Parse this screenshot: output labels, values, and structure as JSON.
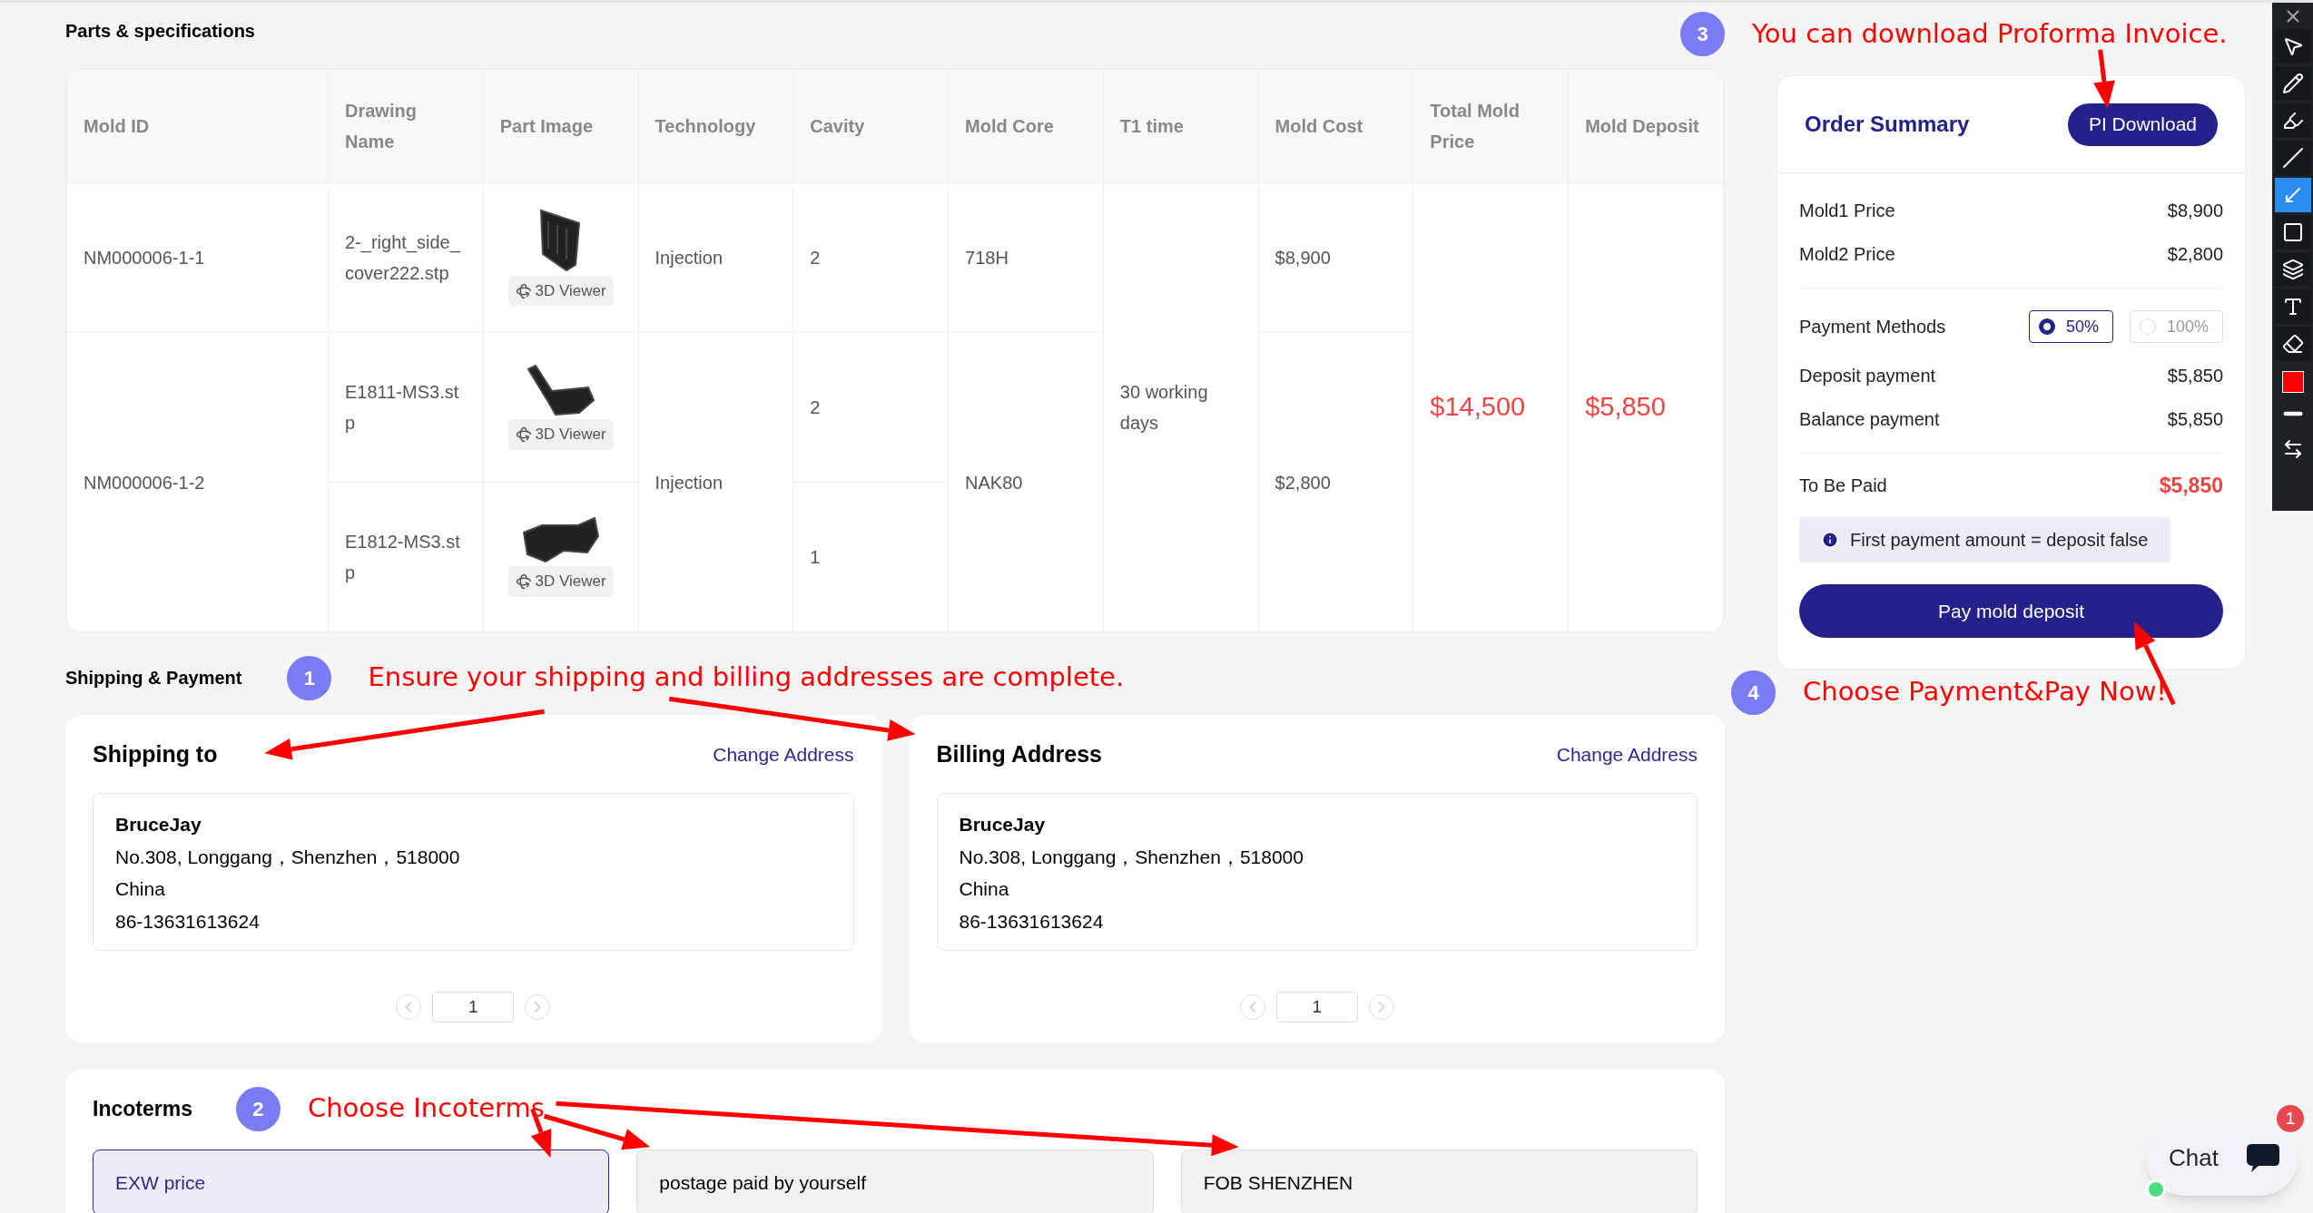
{
  "parts_section": {
    "title": "Parts & specifications"
  },
  "table": {
    "columns": [
      "Mold ID",
      "Drawing Name",
      "Part Image",
      "Technology",
      "Cavity",
      "Mold Core",
      "T1 time",
      "Mold Cost",
      "Total Mold Price",
      "Mold Deposit"
    ],
    "molds": [
      {
        "mold_id": "NM000006-1-1",
        "technology": "Injection",
        "mold_core": "718H",
        "mold_cost": "$8,900",
        "parts": [
          {
            "drawing_name": "2-_right_side_cover222.stp",
            "viewer": "3D Viewer",
            "cavity": "2"
          }
        ]
      },
      {
        "mold_id": "NM000006-1-2",
        "technology": "Injection",
        "mold_core": "NAK80",
        "mold_cost": "$2,800",
        "parts": [
          {
            "drawing_name": "E1811-MS3.stp",
            "viewer": "3D Viewer",
            "cavity": "2"
          },
          {
            "drawing_name": "E1812-MS3.stp",
            "viewer": "3D Viewer",
            "cavity": "1"
          }
        ]
      }
    ],
    "t1_time": "30 working days",
    "total_mold_price": "$14,500",
    "mold_deposit": "$5,850"
  },
  "annotations": [
    {
      "number": "3",
      "text": "You can download Proforma Invoice."
    },
    {
      "number": "1",
      "text": "Ensure your shipping and billing addresses are complete."
    },
    {
      "number": "2",
      "text": "Choose Incoterms"
    },
    {
      "number": "4",
      "text": "Choose Payment&Pay Now!"
    }
  ],
  "shipping": {
    "title": "Shipping & Payment",
    "cards": [
      {
        "title": "Shipping to",
        "link": "Change Address",
        "name": "BruceJay",
        "address_lines": [
          "No.308, Longgang，Shenzhen，518000",
          "China",
          "86-13631613624"
        ],
        "page": "1"
      },
      {
        "title": "Billing Address",
        "link": "Change Address",
        "name": "BruceJay",
        "address_lines": [
          "No.308, Longgang，Shenzhen，518000",
          "China",
          "86-13631613624"
        ],
        "page": "1"
      }
    ]
  },
  "incoterms": {
    "title": "Incoterms",
    "options": [
      {
        "label": "EXW price",
        "selected": true
      },
      {
        "label": "postage paid by yourself",
        "selected": false
      },
      {
        "label": "FOB SHENZHEN",
        "selected": false
      }
    ]
  },
  "order_summary": {
    "title": "Order Summary",
    "download_button": "PI Download",
    "prices": [
      {
        "label": "Mold1 Price",
        "value": "$8,900"
      },
      {
        "label": "Mold2 Price",
        "value": "$2,800"
      }
    ],
    "payment_methods": {
      "label": "Payment Methods",
      "options": [
        {
          "label": "50%",
          "selected": true
        },
        {
          "label": "100%",
          "selected": false
        }
      ]
    },
    "payments": [
      {
        "label": "Deposit payment",
        "value": "$5,850"
      },
      {
        "label": "Balance payment",
        "value": "$5,850"
      }
    ],
    "to_be_paid": {
      "label": "To Be Paid",
      "value": "$5,850"
    },
    "note": "First payment amount = deposit false",
    "pay_button": "Pay mold deposit"
  },
  "annotation_toolbar": {
    "tools": [
      {
        "selected": false
      },
      {
        "selected": false
      },
      {
        "selected": false
      },
      {
        "selected": false
      },
      {
        "selected": true
      },
      {
        "selected": false
      },
      {
        "selected": false
      },
      {
        "selected": false
      },
      {
        "selected": false
      }
    ]
  },
  "chat": {
    "label": "Chat",
    "badge": "1",
    "online": true
  }
}
